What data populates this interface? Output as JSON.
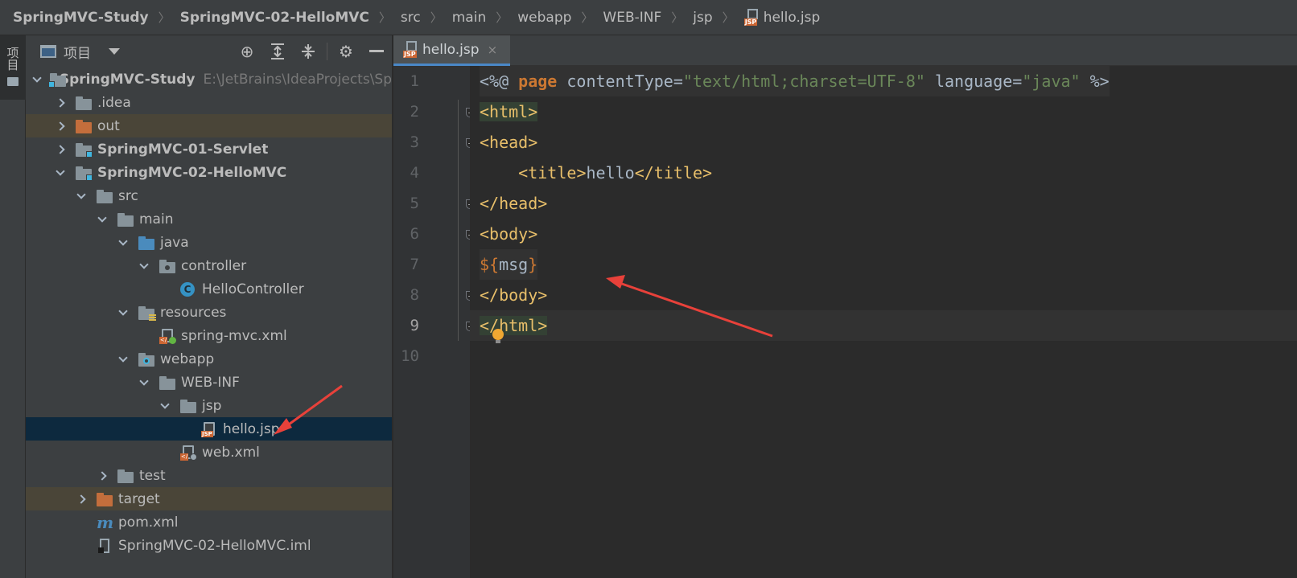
{
  "breadcrumb": {
    "items": [
      "SpringMVC-Study",
      "SpringMVC-02-HelloMVC",
      "src",
      "main",
      "webapp",
      "WEB-INF",
      "jsp",
      "hello.jsp"
    ]
  },
  "toolstrip": {
    "project_label": "项目"
  },
  "project_panel": {
    "title": "项目",
    "tools": [
      "locate-icon",
      "expand-all-icon",
      "collapse-all-icon",
      "gear-icon",
      "minimize-icon"
    ]
  },
  "tree": {
    "root": {
      "label": "SpringMVC-Study",
      "path": "E:\\JetBrains\\IdeaProjects\\Sp"
    },
    "idea": ".idea",
    "out": "out",
    "servlet": "SpringMVC-01-Servlet",
    "hellomvc": "SpringMVC-02-HelloMVC",
    "src": "src",
    "main": "main",
    "java": "java",
    "controller": "controller",
    "hellocontroller": "HelloController",
    "resources": "resources",
    "springmvc_xml": "spring-mvc.xml",
    "webapp": "webapp",
    "webinf": "WEB-INF",
    "jsp": "jsp",
    "hello_jsp": "hello.jsp",
    "web_xml": "web.xml",
    "test": "test",
    "target": "target",
    "pom": "pom.xml",
    "iml": "SpringMVC-02-HelloMVC.iml"
  },
  "editor": {
    "tab": {
      "label": "hello.jsp",
      "close": "×"
    },
    "line_numbers": [
      "1",
      "2",
      "3",
      "4",
      "5",
      "6",
      "7",
      "8",
      "9",
      "10"
    ],
    "code": {
      "l1": {
        "open": "<%@ ",
        "kw": "page",
        "a1": " contentType=",
        "v1": "\"text/html;charset=UTF-8\"",
        "a2": " language=",
        "v2": "\"java\"",
        "close": " %>"
      },
      "l2": {
        "lt": "<",
        "tag": "html",
        "gt": ">"
      },
      "l3": {
        "lt": "<",
        "tag": "head",
        "gt": ">"
      },
      "l4": {
        "indent": "    ",
        "lt": "<",
        "tag": "title",
        "gt": ">",
        "text": "hello",
        "lt2": "</",
        "tag2": "title",
        "gt2": ">"
      },
      "l5": {
        "lt": "</",
        "tag": "head",
        "gt": ">"
      },
      "l6": {
        "lt": "<",
        "tag": "body",
        "gt": ">"
      },
      "l7": {
        "d": "${",
        "expr": "msg",
        "c": "}"
      },
      "l8": {
        "lt": "</",
        "tag": "body",
        "gt": ">"
      },
      "l9": {
        "lt": "</",
        "tag": "html",
        "gt": ">"
      }
    }
  },
  "colors": {
    "annotation_arrow": "#e8413a",
    "accent_tab": "#4a88c7",
    "selected_row": "#0d293e",
    "excluded_row": "#4a4538"
  }
}
